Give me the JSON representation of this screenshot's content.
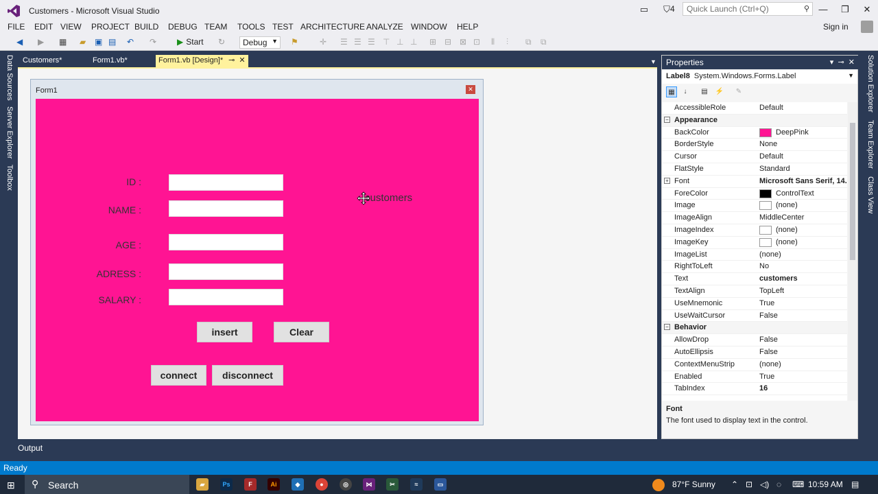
{
  "window": {
    "title": "Customers - Microsoft Visual Studio",
    "notifications_count": "4",
    "quick_launch_placeholder": "Quick Launch (Ctrl+Q)",
    "sign_in": "Sign in"
  },
  "menu": [
    "FILE",
    "EDIT",
    "VIEW",
    "PROJECT",
    "BUILD",
    "DEBUG",
    "TEAM",
    "TOOLS",
    "TEST",
    "ARCHITECTURE",
    "ANALYZE",
    "WINDOW",
    "HELP"
  ],
  "toolbar": {
    "start_label": "Start",
    "config_value": "Debug"
  },
  "left_tabs": [
    "Data Sources",
    "Server Explorer",
    "Toolbox"
  ],
  "right_tabs": [
    "Solution Explorer",
    "Team Explorer",
    "Class View"
  ],
  "doc_tabs": [
    {
      "label": "Customers*"
    },
    {
      "label": "Form1.vb*"
    },
    {
      "label": "Form1.vb [Design]*"
    }
  ],
  "form": {
    "title": "Form1",
    "back_color": "#ff1493",
    "labels": {
      "id": "ID :",
      "name": "NAME :",
      "age": "AGE :",
      "adress": "ADRESS :",
      "salary": "SALARY :"
    },
    "customers_label": "customers",
    "buttons": {
      "insert": "insert",
      "clear": "Clear",
      "connect": "connect",
      "disconnect": "disconnect"
    }
  },
  "properties": {
    "title": "Properties",
    "object_name": "Label8",
    "object_type": "System.Windows.Forms.Label",
    "rows": [
      {
        "name": "AccessibleRole",
        "value": "Default"
      },
      {
        "name": "Appearance",
        "category": true
      },
      {
        "name": "BackColor",
        "value": "DeepPink",
        "swatch": "#ff1493"
      },
      {
        "name": "BorderStyle",
        "value": "None"
      },
      {
        "name": "Cursor",
        "value": "Default"
      },
      {
        "name": "FlatStyle",
        "value": "Standard"
      },
      {
        "name": "Font",
        "value": "Microsoft Sans Serif, 14.",
        "bold": true,
        "expand": true
      },
      {
        "name": "ForeColor",
        "value": "ControlText",
        "swatch": "#000000"
      },
      {
        "name": "Image",
        "value": "(none)",
        "swatch": "#ffffff"
      },
      {
        "name": "ImageAlign",
        "value": "MiddleCenter"
      },
      {
        "name": "ImageIndex",
        "value": "(none)",
        "swatch": "#ffffff"
      },
      {
        "name": "ImageKey",
        "value": "(none)",
        "swatch": "#ffffff"
      },
      {
        "name": "ImageList",
        "value": "(none)"
      },
      {
        "name": "RightToLeft",
        "value": "No"
      },
      {
        "name": "Text",
        "value": "customers",
        "bold": true
      },
      {
        "name": "TextAlign",
        "value": "TopLeft"
      },
      {
        "name": "UseMnemonic",
        "value": "True"
      },
      {
        "name": "UseWaitCursor",
        "value": "False"
      },
      {
        "name": "Behavior",
        "category": true
      },
      {
        "name": "AllowDrop",
        "value": "False"
      },
      {
        "name": "AutoEllipsis",
        "value": "False"
      },
      {
        "name": "ContextMenuStrip",
        "value": "(none)"
      },
      {
        "name": "Enabled",
        "value": "True"
      },
      {
        "name": "TabIndex",
        "value": "16",
        "bold": true
      }
    ],
    "description_title": "Font",
    "description_text": "The font used to display text in the control."
  },
  "output_tab": "Output",
  "status": "Ready",
  "taskbar": {
    "search_label": "Search",
    "weather": "87°F  Sunny",
    "time": "10:59 AM"
  }
}
